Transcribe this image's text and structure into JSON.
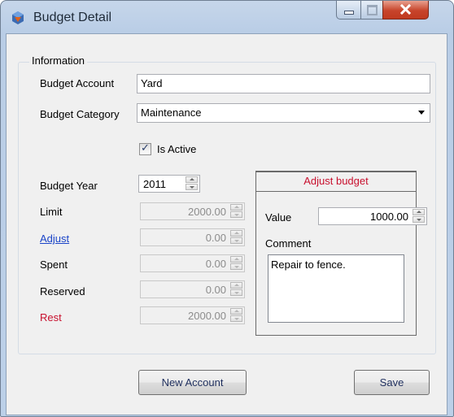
{
  "window": {
    "title": "Budget Detail"
  },
  "group": {
    "title": "Information"
  },
  "fields": {
    "budget_account": {
      "label": "Budget Account",
      "value": "Yard"
    },
    "budget_category": {
      "label": "Budget Category",
      "value": "Maintenance"
    },
    "is_active": {
      "label": "Is Active",
      "checked": true
    },
    "budget_year": {
      "label": "Budget Year",
      "value": "2011"
    },
    "limit": {
      "label": "Limit",
      "value": "2000.00"
    },
    "adjust": {
      "label": "Adjust",
      "value": "0.00"
    },
    "spent": {
      "label": "Spent",
      "value": "0.00"
    },
    "reserved": {
      "label": "Reserved",
      "value": "0.00"
    },
    "rest": {
      "label": "Rest",
      "value": "2000.00"
    }
  },
  "adjust_budget": {
    "title": "Adjust budget",
    "value_label": "Value",
    "value": "1000.00",
    "comment_label": "Comment",
    "comment": "Repair to fence."
  },
  "buttons": {
    "new_account": "New Account",
    "save": "Save"
  },
  "colors": {
    "adjust_link": "#1a44c8",
    "rest_label": "#c8102e",
    "header_text": "#c8102e"
  }
}
